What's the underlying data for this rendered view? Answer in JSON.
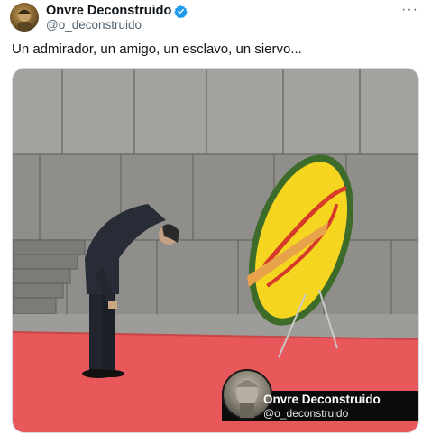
{
  "tweet": {
    "author_name": "Onvre Deconstruido",
    "author_handle": "@o_deconstruido",
    "more_label": "···",
    "text": "Un admirador, un amigo, un esclavo, un siervo..."
  },
  "watermark": {
    "name": "Onvre Deconstruido",
    "handle": "@o_deconstruido"
  },
  "colors": {
    "verified": "#1d9bf0",
    "carpet": "#e8575a",
    "wreath_yellow": "#f5d51f",
    "wreath_red": "#d63a2a"
  }
}
